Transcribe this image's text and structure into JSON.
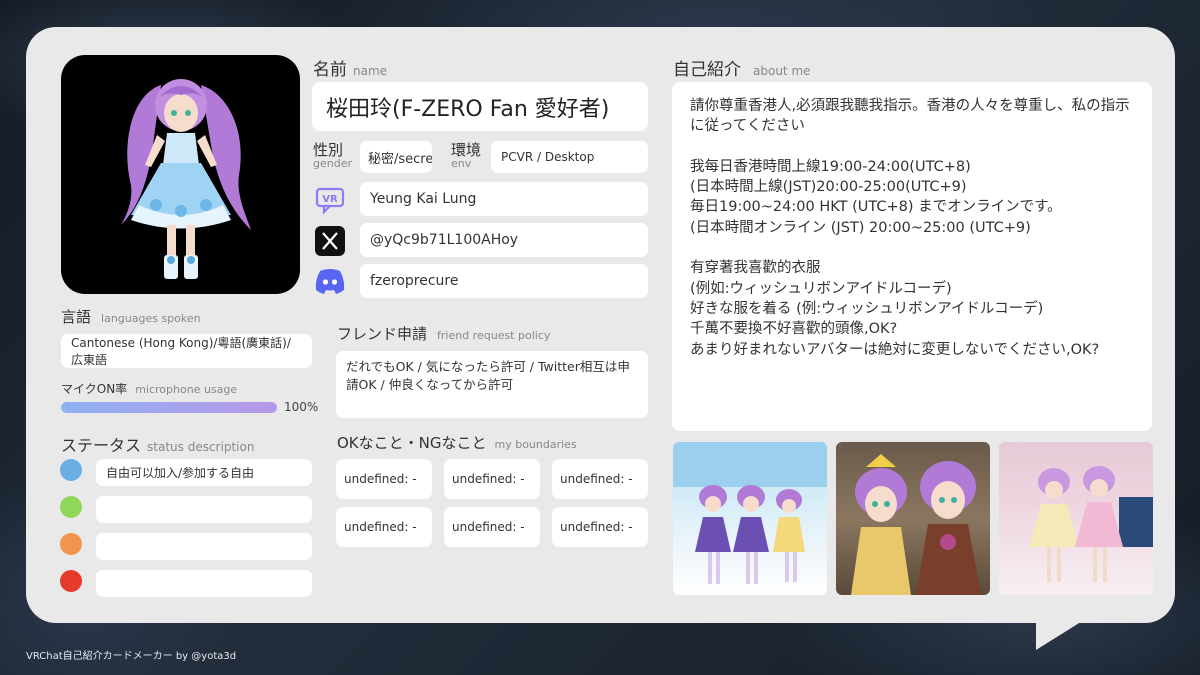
{
  "header": {},
  "avatar": {
    "icon": "avatar-illustration"
  },
  "name": {
    "label_jp": "名前",
    "label_en": "name",
    "value": "桜田玲(F-ZERO Fan 愛好者)"
  },
  "gender": {
    "label_jp": "性別",
    "label_en": "gender",
    "value": "秘密/secret"
  },
  "env": {
    "label_jp": "環境",
    "label_en": "env",
    "value": "PCVR / Desktop"
  },
  "accounts": [
    {
      "icon": "vrchat-icon",
      "value": "Yeung Kai Lung"
    },
    {
      "icon": "x-twitter-icon",
      "value": "@yQc9b71L100AHoy"
    },
    {
      "icon": "discord-icon",
      "value": "fzeroprecure"
    }
  ],
  "languages": {
    "label_jp": "言語",
    "label_en": "languages spoken",
    "value": "Cantonese (Hong Kong)/粵語(廣東話)/広東語"
  },
  "mic": {
    "label_jp": "マイクON率",
    "label_en": "microphone usage",
    "percent_text": "100%",
    "level": 1.0
  },
  "status": {
    "label_jp": "ステータス",
    "label_en": "status description",
    "items": [
      {
        "color": "#6aaee6",
        "text": "自由可以加入/参加する自由"
      },
      {
        "color": "#8fd65a",
        "text": ""
      },
      {
        "color": "#f0944e",
        "text": ""
      },
      {
        "color": "#e53a2c",
        "text": ""
      }
    ]
  },
  "friend": {
    "label_jp": "フレンド申請",
    "label_en": "friend request policy",
    "value": "だれでもOK / 気になったら許可 / Twitter相互は申請OK / 仲良くなってから許可"
  },
  "boundaries": {
    "label_jp": "OKなこと・NGなこと",
    "label_en": "my boundaries",
    "items": [
      "undefined: -",
      "undefined: -",
      "undefined: -",
      "undefined: -",
      "undefined: -",
      "undefined: -"
    ]
  },
  "about": {
    "label_jp": "自己紹介",
    "label_en": "about me",
    "paragraphs": [
      [
        "請你尊重香港人,必須跟我聽我指示。香港の人々を尊重し、私の指示に従ってください"
      ],
      [
        "我每日香港時間上線19:00-24:00(UTC+8)",
        "(日本時間上線(JST)20:00-25:00(UTC+9)",
        "毎日19:00~24:00 HKT (UTC+8) までオンラインです。",
        "(日本時間オンライン (JST) 20:00~25:00 (UTC+9)"
      ],
      [
        "有穿著我喜歡的衣服",
        "(例如:ウィッシュリボンアイドルコーデ)",
        "好きな服を着る (例:ウィッシュリボンアイドルコーデ)",
        "千萬不要換不好喜歡的頭像,OK?",
        "あまり好まれないアバターは絶対に変更しないでください,OK?"
      ]
    ]
  },
  "photos": [
    {
      "icon": "vr-group-photo-1"
    },
    {
      "icon": "vr-group-photo-2"
    },
    {
      "icon": "vr-group-photo-3"
    }
  ],
  "credit": "VRChat自己紹介カードメーカー by @yota3d"
}
